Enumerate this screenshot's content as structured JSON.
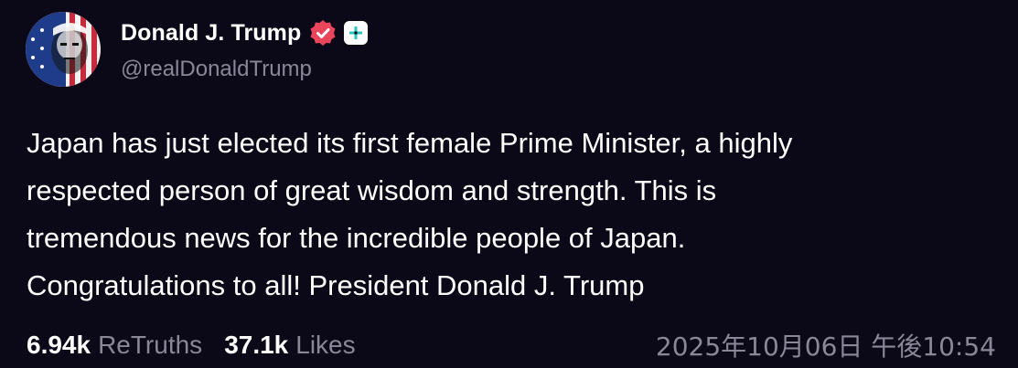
{
  "author": {
    "display_name": "Donald J. Trump",
    "handle": "@realDonaldTrump",
    "avatar_icon": "flag-portrait-avatar",
    "verified_icon": "verified-badge-icon",
    "plus_icon": "plus-subscription-icon"
  },
  "post": {
    "text": "Japan has just elected its first female Prime Minister, a highly\nrespected person of great wisdom and strength. This is\ntremendous news for the incredible people of Japan.\nCongratulations to all! President Donald J. Trump"
  },
  "stats": {
    "retruths_count": "6.94k",
    "retruths_label": "ReTruths",
    "likes_count": "37.1k",
    "likes_label": "Likes"
  },
  "timestamp": "2025年10月06日 午後10:54",
  "colors": {
    "background": "#0b0817",
    "muted_text": "#8a8799",
    "verified_badge": "#e9465b",
    "plus_accent": "#27c6c0"
  }
}
